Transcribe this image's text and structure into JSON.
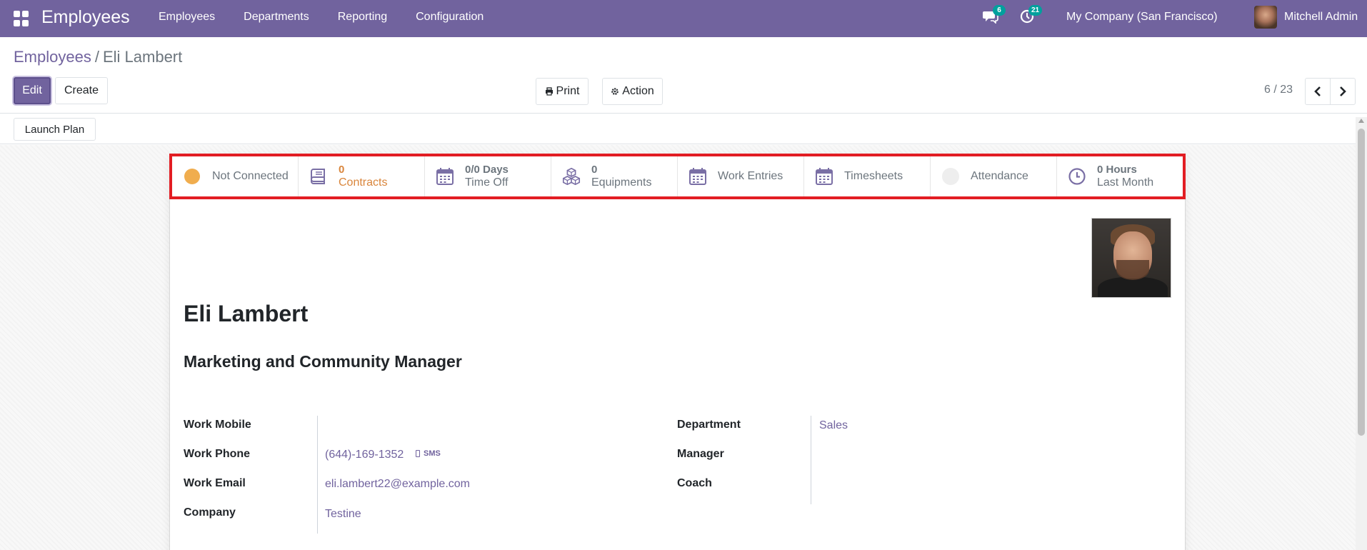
{
  "navbar": {
    "app_title": "Employees",
    "menu": [
      "Employees",
      "Departments",
      "Reporting",
      "Configuration"
    ],
    "messages_count": "6",
    "activities_count": "21",
    "company": "My Company (San Francisco)",
    "user": "Mitchell Admin",
    "color": "#71639e"
  },
  "breadcrumb": {
    "parent": "Employees",
    "separator": "/",
    "current": "Eli Lambert"
  },
  "toolbar": {
    "edit_label": "Edit",
    "create_label": "Create",
    "print_label": "Print",
    "action_label": "Action",
    "pager": "6 / 23"
  },
  "statusbar": {
    "launch_plan_label": "Launch Plan"
  },
  "smart_buttons": {
    "presence": "Not Connected",
    "contracts_value": "0",
    "contracts_label": "Contracts",
    "timeoff_value": "0/0 Days",
    "timeoff_label": "Time Off",
    "equipments_value": "0",
    "equipments_label": "Equipments",
    "work_entries": "Work Entries",
    "timesheets": "Timesheets",
    "attendance": "Attendance",
    "hours_value": "0 Hours",
    "hours_label": "Last Month"
  },
  "employee": {
    "name": "Eli Lambert",
    "job_title": "Marketing and Community Manager",
    "fields_left": [
      {
        "label": "Work Mobile",
        "value": ""
      },
      {
        "label": "Work Phone",
        "value": "(644)-169-1352"
      },
      {
        "label": "Work Email",
        "value": "eli.lambert22@example.com"
      },
      {
        "label": "Company",
        "value": "Testine"
      }
    ],
    "fields_right": [
      {
        "label": "Department",
        "value": "Sales"
      },
      {
        "label": "Manager",
        "value": ""
      },
      {
        "label": "Coach",
        "value": ""
      }
    ],
    "sms_label": "SMS"
  }
}
